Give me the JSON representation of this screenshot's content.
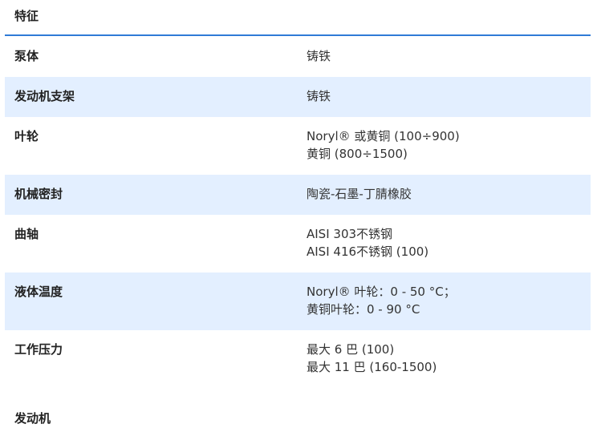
{
  "features": {
    "title": "特征",
    "rows": [
      {
        "label": "泵体",
        "values": [
          "铸铁"
        ]
      },
      {
        "label": "发动机支架",
        "values": [
          "铸铁"
        ]
      },
      {
        "label": "叶轮",
        "values": [
          "Noryl® 或黄铜 (100÷900)",
          "黄铜 (800÷1500)"
        ]
      },
      {
        "label": "机械密封",
        "values": [
          "陶瓷-石墨-丁腈橡胶"
        ]
      },
      {
        "label": "曲轴",
        "values": [
          "AISI 303不锈钢",
          "AISI 416不锈钢 (100)"
        ]
      },
      {
        "label": "液体温度",
        "values": [
          "Noryl® 叶轮：0 - 50 °C；",
          "黄铜叶轮：0 - 90 °C"
        ]
      },
      {
        "label": "工作压力",
        "values": [
          "最大 6 巴 (100)",
          "最大 11 巴 (160-1500)"
        ]
      }
    ]
  },
  "motor": {
    "title": "发动机"
  },
  "colors": {
    "accent_rule": "#2f7bd6",
    "row_shade": "#e3efff"
  }
}
